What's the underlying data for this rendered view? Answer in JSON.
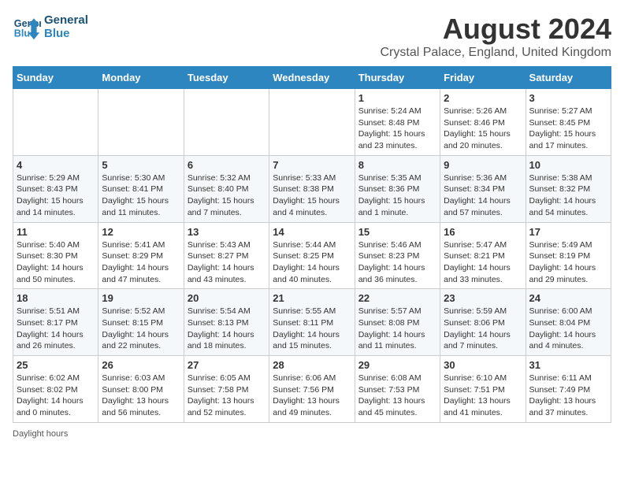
{
  "logo": {
    "line1": "General",
    "line2": "Blue"
  },
  "title": "August 2024",
  "subtitle": "Crystal Palace, England, United Kingdom",
  "footer": "Daylight hours",
  "days_of_week": [
    "Sunday",
    "Monday",
    "Tuesday",
    "Wednesday",
    "Thursday",
    "Friday",
    "Saturday"
  ],
  "weeks": [
    [
      {
        "num": "",
        "info": ""
      },
      {
        "num": "",
        "info": ""
      },
      {
        "num": "",
        "info": ""
      },
      {
        "num": "",
        "info": ""
      },
      {
        "num": "1",
        "info": "Sunrise: 5:24 AM\nSunset: 8:48 PM\nDaylight: 15 hours\nand 23 minutes."
      },
      {
        "num": "2",
        "info": "Sunrise: 5:26 AM\nSunset: 8:46 PM\nDaylight: 15 hours\nand 20 minutes."
      },
      {
        "num": "3",
        "info": "Sunrise: 5:27 AM\nSunset: 8:45 PM\nDaylight: 15 hours\nand 17 minutes."
      }
    ],
    [
      {
        "num": "4",
        "info": "Sunrise: 5:29 AM\nSunset: 8:43 PM\nDaylight: 15 hours\nand 14 minutes."
      },
      {
        "num": "5",
        "info": "Sunrise: 5:30 AM\nSunset: 8:41 PM\nDaylight: 15 hours\nand 11 minutes."
      },
      {
        "num": "6",
        "info": "Sunrise: 5:32 AM\nSunset: 8:40 PM\nDaylight: 15 hours\nand 7 minutes."
      },
      {
        "num": "7",
        "info": "Sunrise: 5:33 AM\nSunset: 8:38 PM\nDaylight: 15 hours\nand 4 minutes."
      },
      {
        "num": "8",
        "info": "Sunrise: 5:35 AM\nSunset: 8:36 PM\nDaylight: 15 hours\nand 1 minute."
      },
      {
        "num": "9",
        "info": "Sunrise: 5:36 AM\nSunset: 8:34 PM\nDaylight: 14 hours\nand 57 minutes."
      },
      {
        "num": "10",
        "info": "Sunrise: 5:38 AM\nSunset: 8:32 PM\nDaylight: 14 hours\nand 54 minutes."
      }
    ],
    [
      {
        "num": "11",
        "info": "Sunrise: 5:40 AM\nSunset: 8:30 PM\nDaylight: 14 hours\nand 50 minutes."
      },
      {
        "num": "12",
        "info": "Sunrise: 5:41 AM\nSunset: 8:29 PM\nDaylight: 14 hours\nand 47 minutes."
      },
      {
        "num": "13",
        "info": "Sunrise: 5:43 AM\nSunset: 8:27 PM\nDaylight: 14 hours\nand 43 minutes."
      },
      {
        "num": "14",
        "info": "Sunrise: 5:44 AM\nSunset: 8:25 PM\nDaylight: 14 hours\nand 40 minutes."
      },
      {
        "num": "15",
        "info": "Sunrise: 5:46 AM\nSunset: 8:23 PM\nDaylight: 14 hours\nand 36 minutes."
      },
      {
        "num": "16",
        "info": "Sunrise: 5:47 AM\nSunset: 8:21 PM\nDaylight: 14 hours\nand 33 minutes."
      },
      {
        "num": "17",
        "info": "Sunrise: 5:49 AM\nSunset: 8:19 PM\nDaylight: 14 hours\nand 29 minutes."
      }
    ],
    [
      {
        "num": "18",
        "info": "Sunrise: 5:51 AM\nSunset: 8:17 PM\nDaylight: 14 hours\nand 26 minutes."
      },
      {
        "num": "19",
        "info": "Sunrise: 5:52 AM\nSunset: 8:15 PM\nDaylight: 14 hours\nand 22 minutes."
      },
      {
        "num": "20",
        "info": "Sunrise: 5:54 AM\nSunset: 8:13 PM\nDaylight: 14 hours\nand 18 minutes."
      },
      {
        "num": "21",
        "info": "Sunrise: 5:55 AM\nSunset: 8:11 PM\nDaylight: 14 hours\nand 15 minutes."
      },
      {
        "num": "22",
        "info": "Sunrise: 5:57 AM\nSunset: 8:08 PM\nDaylight: 14 hours\nand 11 minutes."
      },
      {
        "num": "23",
        "info": "Sunrise: 5:59 AM\nSunset: 8:06 PM\nDaylight: 14 hours\nand 7 minutes."
      },
      {
        "num": "24",
        "info": "Sunrise: 6:00 AM\nSunset: 8:04 PM\nDaylight: 14 hours\nand 4 minutes."
      }
    ],
    [
      {
        "num": "25",
        "info": "Sunrise: 6:02 AM\nSunset: 8:02 PM\nDaylight: 14 hours\nand 0 minutes."
      },
      {
        "num": "26",
        "info": "Sunrise: 6:03 AM\nSunset: 8:00 PM\nDaylight: 13 hours\nand 56 minutes."
      },
      {
        "num": "27",
        "info": "Sunrise: 6:05 AM\nSunset: 7:58 PM\nDaylight: 13 hours\nand 52 minutes."
      },
      {
        "num": "28",
        "info": "Sunrise: 6:06 AM\nSunset: 7:56 PM\nDaylight: 13 hours\nand 49 minutes."
      },
      {
        "num": "29",
        "info": "Sunrise: 6:08 AM\nSunset: 7:53 PM\nDaylight: 13 hours\nand 45 minutes."
      },
      {
        "num": "30",
        "info": "Sunrise: 6:10 AM\nSunset: 7:51 PM\nDaylight: 13 hours\nand 41 minutes."
      },
      {
        "num": "31",
        "info": "Sunrise: 6:11 AM\nSunset: 7:49 PM\nDaylight: 13 hours\nand 37 minutes."
      }
    ]
  ]
}
